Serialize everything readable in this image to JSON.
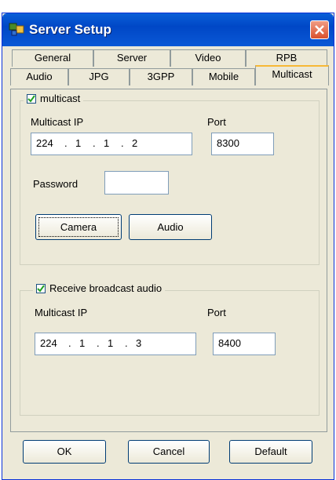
{
  "window": {
    "title": "Server Setup"
  },
  "tabs": {
    "row1": [
      "General",
      "Server",
      "Video",
      "RPB"
    ],
    "row2": [
      "Audio",
      "JPG",
      "3GPP",
      "Mobile",
      "Multicast"
    ],
    "active": "Multicast"
  },
  "multicast_group": {
    "checkbox_label": "multicast",
    "checked": true,
    "ip_label": "Multicast IP",
    "ip": [
      "224",
      "1",
      "1",
      "2"
    ],
    "port_label": "Port",
    "port": "8300",
    "password_label": "Password",
    "password": "",
    "camera_button": "Camera",
    "audio_button": "Audio"
  },
  "broadcast_group": {
    "checkbox_label": "Receive broadcast audio",
    "checked": true,
    "ip_label": "Multicast IP",
    "ip": [
      "224",
      "1",
      "1",
      "3"
    ],
    "port_label": "Port",
    "port": "8400"
  },
  "footer": {
    "ok": "OK",
    "cancel": "Cancel",
    "default": "Default"
  },
  "ip_separator": "."
}
